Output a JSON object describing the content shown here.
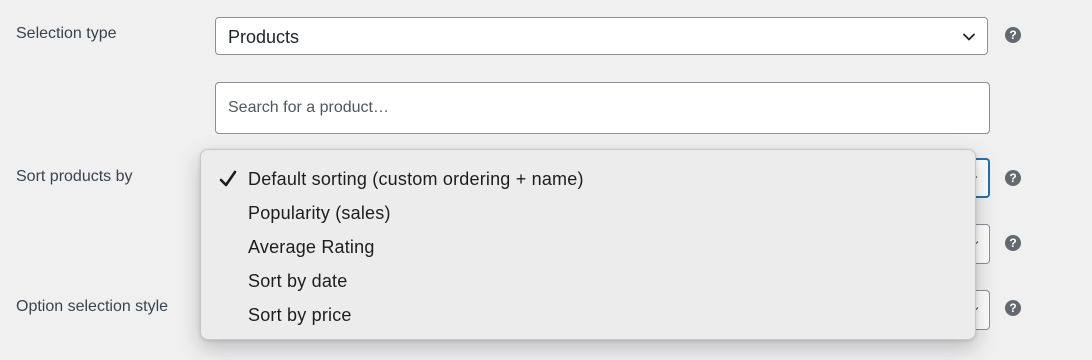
{
  "fields": {
    "selection_type": {
      "label": "Selection type",
      "value": "Products",
      "help": "?"
    },
    "search": {
      "placeholder": "Search for a product…",
      "value": ""
    },
    "sort_products_by": {
      "label": "Sort products by",
      "help": "?"
    },
    "hidden_field": {
      "help": "?"
    },
    "option_selection_style": {
      "label": "Option selection style",
      "help": "?"
    }
  },
  "sort_dropdown": {
    "selected": "Default sorting (custom ordering + name)",
    "options": [
      {
        "label": "Default sorting (custom ordering + name)",
        "checked": true
      },
      {
        "label": "Popularity (sales)",
        "checked": false
      },
      {
        "label": "Average Rating",
        "checked": false
      },
      {
        "label": "Sort by date",
        "checked": false
      },
      {
        "label": "Sort by price",
        "checked": false
      }
    ]
  },
  "icons": {
    "check": "checkmark-icon",
    "chevron": "chevron-down-icon",
    "help": "help-circle-icon"
  },
  "colors": {
    "focus": "#2271b1",
    "border": "#8c8f94",
    "background": "#f0f0f1"
  }
}
